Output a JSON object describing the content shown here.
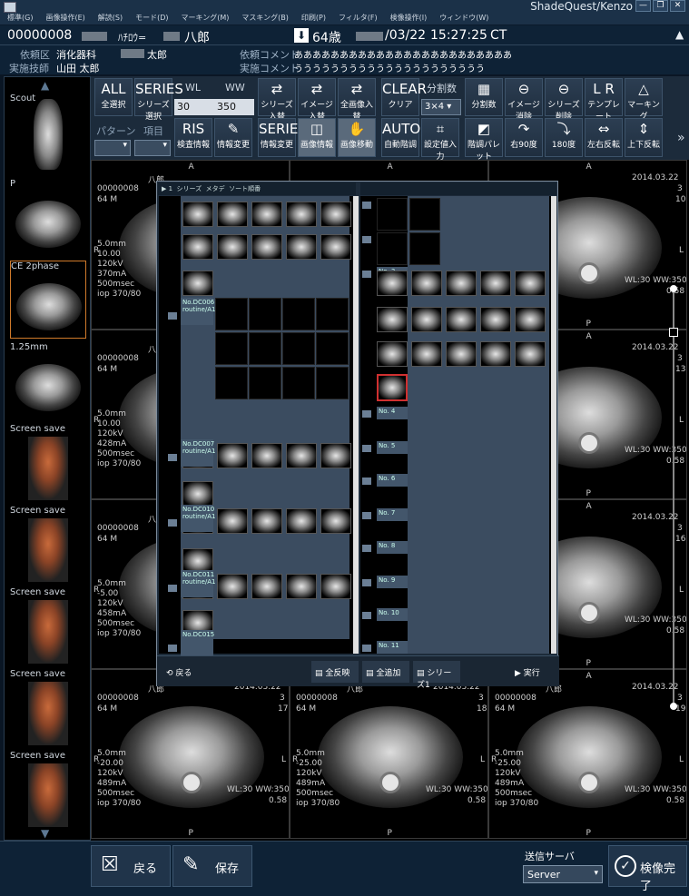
{
  "app": {
    "title": "ShadeQuest/Kenzo"
  },
  "menu": [
    "標準(G)",
    "画像操作(E)",
    "解読(S)",
    "モード(D)",
    "マーキング(M)",
    "マスキング(B)",
    "印刷(P)",
    "フィルタ(F)",
    "検像操作(I)",
    "ウィンドウ(W)"
  ],
  "patient": {
    "id": "00000008",
    "name_kana": "ﾊﾁﾛｳ=",
    "name_kanji": "八郎",
    "age": "64歳",
    "date_fragment": "/03/22",
    "time": "15:27:25",
    "modality": "CT",
    "dept_label": "依頼区",
    "dept_value": "消化器科",
    "doctor_suffix": "太郎",
    "tech_label": "実施技師",
    "tech_value": "山田 太郎",
    "req_comment_label": "依頼コメント",
    "req_comment": "ああああああああああああああああああああああああ",
    "exec_comment_label": "実施コメント",
    "exec_comment": "ううううううううううううううううううううう"
  },
  "thumbnails": [
    "Scout",
    "P",
    "CE 2phase",
    "1.25mm",
    "Screen save",
    "Screen save",
    "Screen save",
    "Screen save",
    "Screen save"
  ],
  "toolbar": {
    "row1": [
      {
        "label": "全選択",
        "icon": "ALL"
      },
      {
        "label": "シリーズ選択",
        "icon": "SERIES"
      },
      {
        "label": "シリーズ入替",
        "icon": "⇄"
      },
      {
        "label": "イメージ入替",
        "icon": "⇄"
      },
      {
        "label": "全画像入替",
        "icon": "⇄"
      },
      {
        "label": "クリア",
        "icon": "CLEAR"
      },
      {
        "label": "分割数",
        "icon": "▦"
      },
      {
        "label": "イメージ消除",
        "icon": "⊖"
      },
      {
        "label": "シリーズ削除",
        "icon": "⊖"
      },
      {
        "label": "テンプレート",
        "icon": "L R"
      },
      {
        "label": "マーキング",
        "icon": "△"
      }
    ],
    "wl_label": "WL",
    "ww_label": "WW",
    "wl_value": "30",
    "ww_value": "350",
    "split_label": "分割数",
    "split_value": "3×4",
    "pattern_label": "パターン",
    "item_label": "項目",
    "row2": [
      {
        "label": "検査情報",
        "icon": "RIS"
      },
      {
        "label": "情報変更",
        "icon": "✎"
      },
      {
        "label": "情報変更",
        "icon": "SERIES"
      },
      {
        "label": "画像情報",
        "icon": "◫"
      },
      {
        "label": "画像移動",
        "icon": "✋"
      },
      {
        "label": "自動階調",
        "icon": "AUTO"
      },
      {
        "label": "設定値入力",
        "icon": "⌗"
      },
      {
        "label": "階調パレット",
        "icon": "◩"
      },
      {
        "label": "右90度",
        "icon": "↷"
      },
      {
        "label": "180度",
        "icon": "⤵"
      },
      {
        "label": "左右反転",
        "icon": "⇔"
      },
      {
        "label": "上下反転",
        "icon": "⇕"
      }
    ],
    "more": "»"
  },
  "viewer": {
    "cells": [
      {
        "date": "2014.03.22",
        "num": "3",
        "total": "10",
        "series": "00000008",
        "age": "64 M",
        "orient_top": "A",
        "orient_bottom": "P",
        "ww": "WL:30 WW:350",
        "thick": "0.58"
      },
      {
        "date": "2014.03.22",
        "num": "3",
        "total": "13"
      },
      {
        "date": "2014.03.22",
        "num": "3",
        "total": "16"
      },
      {
        "date": "2014.03.22",
        "num": "3",
        "total": "17"
      },
      {
        "date": "2014.03.22",
        "num": "3",
        "total": "18"
      },
      {
        "date": "2014.03.22",
        "num": "3",
        "total": "19"
      }
    ],
    "scan": {
      "slice": "5.0mm",
      "pos1": "-5.00",
      "pos2": "-20.00",
      "pos3": "-25.00",
      "pos4": "10.00",
      "kv": "120kV",
      "ma1": "370mA",
      "ma2": "428mA",
      "ma3": "458mA",
      "ma4": "489mA",
      "ma5": "490mA",
      "msec": "500msec",
      "iop": "iop 370/80",
      "ww_text": "WL:30 WW:350",
      "thick": "0.58",
      "name": "八郎"
    }
  },
  "dialog": {
    "left_header": [
      "▶ 1",
      "シリーズ",
      "メタデ",
      "ソート順番"
    ],
    "groups": [
      "No.DC006",
      "No.DC007",
      "No.DC010",
      "No.DC011",
      "No.DC015"
    ],
    "group_sub": [
      "routine/A1",
      "routine/A1",
      "routine/A1",
      "routine/A1"
    ],
    "right_no": [
      "No. 1",
      "No. 2",
      "No. 3",
      "No. 4",
      "No. 5",
      "No. 6",
      "No. 7",
      "No. 8",
      "No. 9",
      "No. 10",
      "No. 11"
    ],
    "buttons": {
      "back": "戻る",
      "all_reverse": "全反映",
      "all_add": "全追加",
      "series_set": "シリーズ1",
      "execute": "実行"
    }
  },
  "bottom": {
    "back_label": "戻る",
    "save_label": "保存",
    "server_label": "送信サーバ",
    "server_value": "Server",
    "complete_label": "検像完了"
  }
}
